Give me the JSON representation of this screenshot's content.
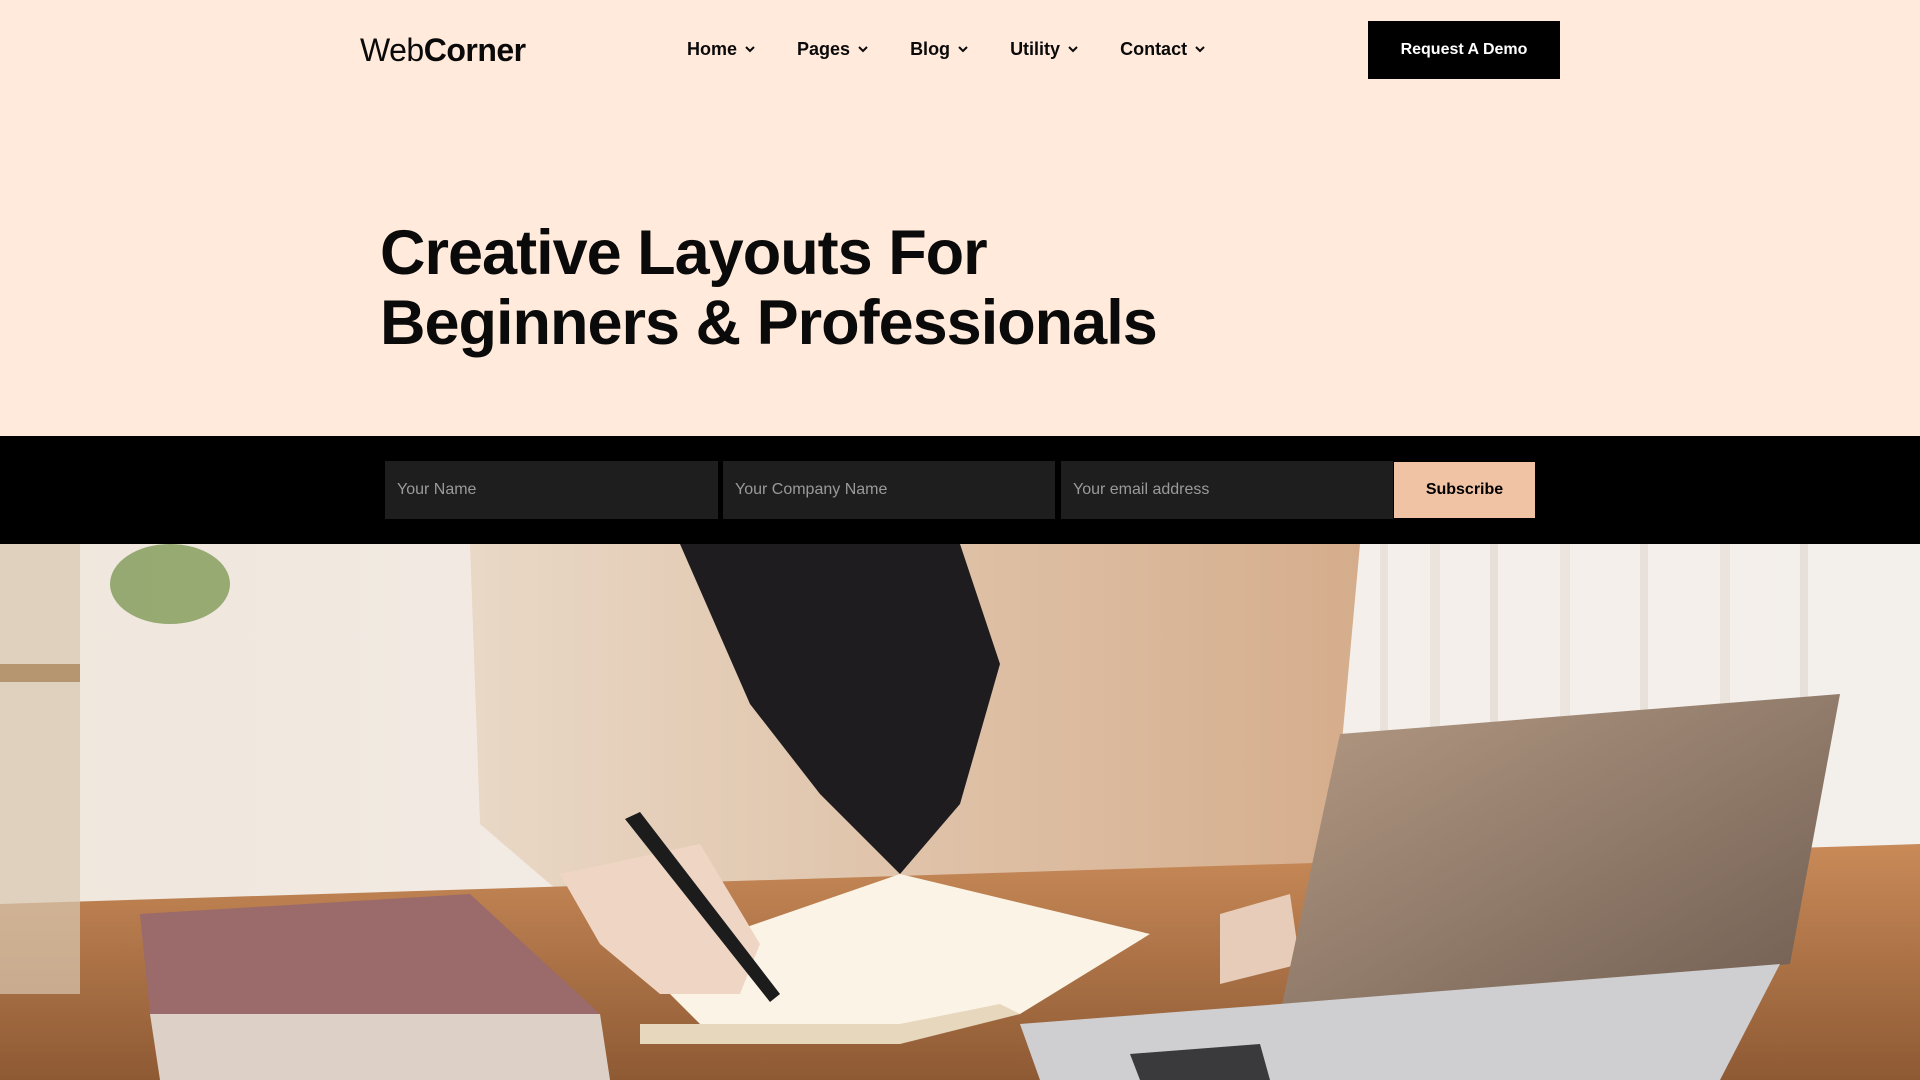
{
  "brand": {
    "logo_light": "Web",
    "logo_bold": "Corner"
  },
  "nav": {
    "items": [
      {
        "label": "Home"
      },
      {
        "label": "Pages"
      },
      {
        "label": "Blog"
      },
      {
        "label": "Utility"
      },
      {
        "label": "Contact"
      }
    ]
  },
  "header": {
    "cta_label": "Request A Demo"
  },
  "hero": {
    "title_line1": "Creative Layouts For",
    "title_line2": "Beginners & Professionals"
  },
  "form": {
    "name_placeholder": "Your Name",
    "company_placeholder": "Your Company Name",
    "email_placeholder": "Your email address",
    "submit_label": "Subscribe"
  },
  "colors": {
    "page_bg": "#ffeadb",
    "band_bg": "#000000",
    "field_bg": "#1e1e1e",
    "accent": "#f0c3a4"
  },
  "photo": {
    "subject": "woman-writing-in-notebook-with-laptop-image"
  }
}
